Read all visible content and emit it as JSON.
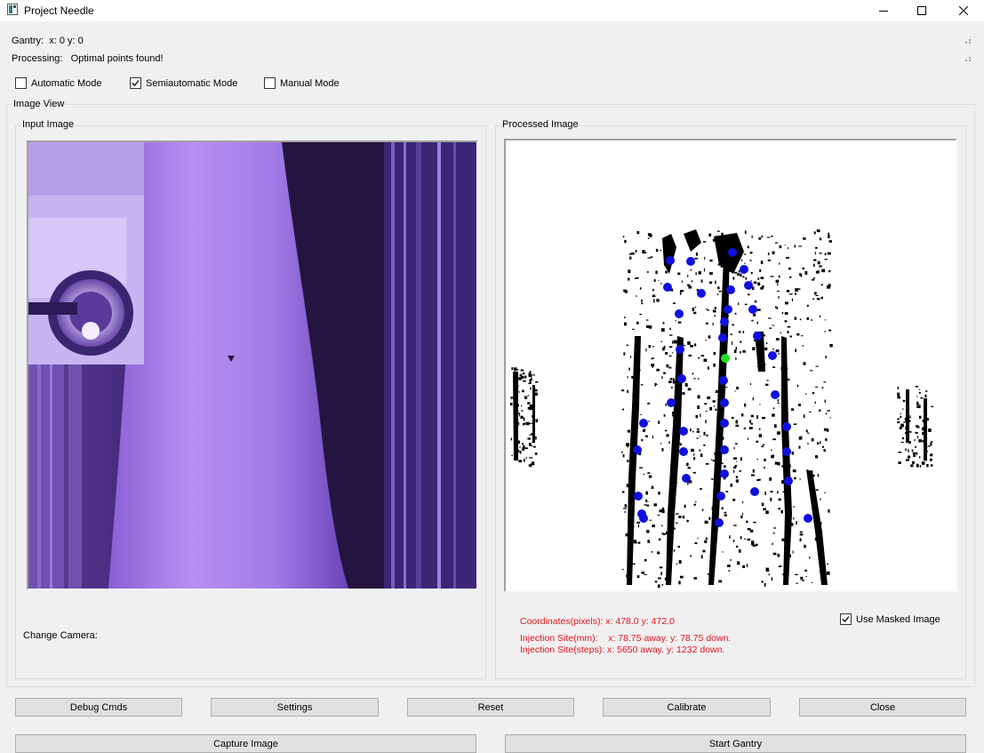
{
  "window": {
    "title": "Project Needle"
  },
  "status": {
    "gantry_label": "Gantry:",
    "gantry_value": "x: 0 y: 0",
    "processing_label": "Processing:",
    "processing_value": "Optimal points found!"
  },
  "modes": [
    {
      "label": "Automatic Mode",
      "checked": false
    },
    {
      "label": "Semiautomatic Mode",
      "checked": true
    },
    {
      "label": "Manual Mode",
      "checked": false
    }
  ],
  "image_view": {
    "title": "Image View",
    "input_panel": {
      "title": "Input Image",
      "change_camera_label": "Change Camera:"
    },
    "processed_panel": {
      "title": "Processed Image",
      "coordinates": "Coordinates(pixels): x: 478.0 y: 472.0",
      "injection_mm": "Injection Site(mm):    x: 78.75 away. y: 78.75 down.",
      "injection_steps": "Injection Site(steps): x: 5650 away. y: 1232 down.",
      "use_masked_label": "Use Masked Image",
      "use_masked_checked": true
    }
  },
  "buttons_row1": [
    "Debug Cmds",
    "Settings",
    "Reset",
    "Calibrate",
    "Close"
  ],
  "buttons_row2": [
    "Capture Image",
    "Start Gantry"
  ],
  "colors": {
    "error_text": "#e0141e",
    "point_blue": "#1010e0",
    "point_selected": "#22dd22",
    "input_tint": "#6a3fb5"
  },
  "icons": [
    "app-icon",
    "minimize-icon",
    "maximize-icon",
    "close-icon",
    "size-grip-icon",
    "checkmark-icon"
  ]
}
